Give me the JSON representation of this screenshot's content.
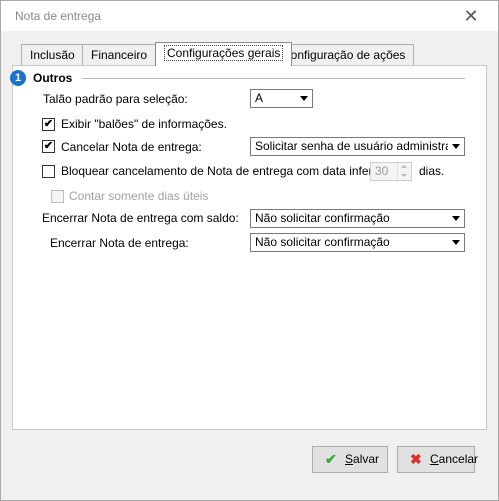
{
  "window": {
    "title": "Nota de entrega",
    "close_glyph": "✕"
  },
  "tabs": [
    {
      "label": "Inclusão",
      "active": false
    },
    {
      "label": "Financeiro",
      "active": false
    },
    {
      "label": "Configurações gerais",
      "active": true
    },
    {
      "label": "Configuração de ações",
      "active": false
    }
  ],
  "section": {
    "badge": "1",
    "title": "Outros"
  },
  "fields": {
    "talao": {
      "label": "Talão padrão para seleção:",
      "value": "A"
    },
    "exibir_baloes": {
      "label": "Exibir \"balões\" de informações.",
      "checked": true
    },
    "cancelar_nota": {
      "label": "Cancelar Nota de entrega:",
      "checked": true,
      "value": "Solicitar senha de usuário administrador"
    },
    "bloquear": {
      "label": "Bloquear cancelamento de Nota de entrega com data inferior à:",
      "checked": false,
      "days_value": "30",
      "days_suffix": "dias."
    },
    "contar_uteis": {
      "label": "Contar somente dias úteis",
      "checked": false,
      "disabled": true
    },
    "encerrar_saldo": {
      "label": "Encerrar Nota de entrega com saldo:",
      "value": "Não solicitar confirmação"
    },
    "encerrar": {
      "label": "Encerrar Nota de entrega:",
      "value": "Não solicitar confirmação"
    }
  },
  "buttons": {
    "salvar": {
      "icon": "check-icon",
      "label_first": "S",
      "label_rest": "alvar",
      "color": "#3aa832"
    },
    "cancelar": {
      "icon": "x-icon",
      "label_first": "C",
      "label_rest": "ancelar",
      "color": "#d9322b"
    }
  },
  "check_mark": "✔",
  "icons": {
    "salvar": "✔",
    "cancelar": "✖"
  }
}
